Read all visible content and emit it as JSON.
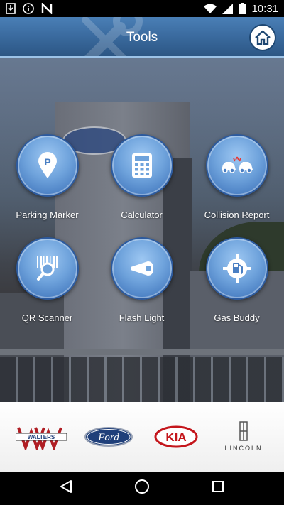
{
  "status_bar": {
    "time": "10:31",
    "icons": [
      "download-icon",
      "info-icon",
      "n-icon",
      "wifi-icon",
      "signal-icon",
      "battery-icon"
    ]
  },
  "header": {
    "title": "Tools",
    "home_icon": "home-icon",
    "background_color": "#3a6a9e"
  },
  "tools": [
    {
      "label": "Parking Marker",
      "icon": "parking-marker-icon"
    },
    {
      "label": "Calculator",
      "icon": "calculator-icon"
    },
    {
      "label": "Collision Report",
      "icon": "collision-icon"
    },
    {
      "label": "QR Scanner",
      "icon": "qr-scanner-icon"
    },
    {
      "label": "Flash Light",
      "icon": "flashlight-icon"
    },
    {
      "label": "Gas Buddy",
      "icon": "gas-pump-icon"
    }
  ],
  "brands": {
    "walters_text": "WALTERS",
    "ford_text": "Ford",
    "kia_text": "KIA",
    "lincoln_text": "LINCOLN"
  },
  "nav": {
    "icons": [
      "back-icon",
      "home-nav-icon",
      "recents-icon"
    ]
  },
  "colors": {
    "tool_button": "#6fa3dc",
    "header": "#3a6a9e",
    "kia_red": "#c4161c",
    "ford_blue": "#1f3f7a",
    "walters_red": "#b01e24"
  }
}
